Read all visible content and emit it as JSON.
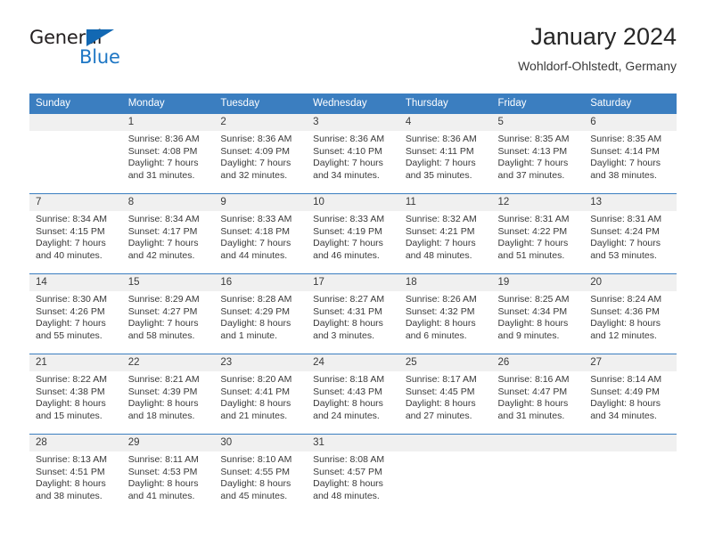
{
  "brand": {
    "name_part1": "General",
    "name_part2": "Blue",
    "accent_color": "#1d76c4",
    "triangle_color": "#1268b3"
  },
  "header": {
    "title": "January 2024",
    "subtitle": "Wohldorf-Ohlstedt, Germany",
    "header_bg_color": "#3b7ec0",
    "daynum_bg_color": "#f0f0f0"
  },
  "weekday_headers": [
    "Sunday",
    "Monday",
    "Tuesday",
    "Wednesday",
    "Thursday",
    "Friday",
    "Saturday"
  ],
  "weeks": [
    [
      {
        "date": "",
        "empty": true,
        "sunrise": "",
        "sunset": "",
        "daylight_line1": "",
        "daylight_line2": ""
      },
      {
        "date": "1",
        "empty": false,
        "sunrise": "Sunrise: 8:36 AM",
        "sunset": "Sunset: 4:08 PM",
        "daylight_line1": "Daylight: 7 hours",
        "daylight_line2": "and 31 minutes."
      },
      {
        "date": "2",
        "empty": false,
        "sunrise": "Sunrise: 8:36 AM",
        "sunset": "Sunset: 4:09 PM",
        "daylight_line1": "Daylight: 7 hours",
        "daylight_line2": "and 32 minutes."
      },
      {
        "date": "3",
        "empty": false,
        "sunrise": "Sunrise: 8:36 AM",
        "sunset": "Sunset: 4:10 PM",
        "daylight_line1": "Daylight: 7 hours",
        "daylight_line2": "and 34 minutes."
      },
      {
        "date": "4",
        "empty": false,
        "sunrise": "Sunrise: 8:36 AM",
        "sunset": "Sunset: 4:11 PM",
        "daylight_line1": "Daylight: 7 hours",
        "daylight_line2": "and 35 minutes."
      },
      {
        "date": "5",
        "empty": false,
        "sunrise": "Sunrise: 8:35 AM",
        "sunset": "Sunset: 4:13 PM",
        "daylight_line1": "Daylight: 7 hours",
        "daylight_line2": "and 37 minutes."
      },
      {
        "date": "6",
        "empty": false,
        "sunrise": "Sunrise: 8:35 AM",
        "sunset": "Sunset: 4:14 PM",
        "daylight_line1": "Daylight: 7 hours",
        "daylight_line2": "and 38 minutes."
      }
    ],
    [
      {
        "date": "7",
        "empty": false,
        "sunrise": "Sunrise: 8:34 AM",
        "sunset": "Sunset: 4:15 PM",
        "daylight_line1": "Daylight: 7 hours",
        "daylight_line2": "and 40 minutes."
      },
      {
        "date": "8",
        "empty": false,
        "sunrise": "Sunrise: 8:34 AM",
        "sunset": "Sunset: 4:17 PM",
        "daylight_line1": "Daylight: 7 hours",
        "daylight_line2": "and 42 minutes."
      },
      {
        "date": "9",
        "empty": false,
        "sunrise": "Sunrise: 8:33 AM",
        "sunset": "Sunset: 4:18 PM",
        "daylight_line1": "Daylight: 7 hours",
        "daylight_line2": "and 44 minutes."
      },
      {
        "date": "10",
        "empty": false,
        "sunrise": "Sunrise: 8:33 AM",
        "sunset": "Sunset: 4:19 PM",
        "daylight_line1": "Daylight: 7 hours",
        "daylight_line2": "and 46 minutes."
      },
      {
        "date": "11",
        "empty": false,
        "sunrise": "Sunrise: 8:32 AM",
        "sunset": "Sunset: 4:21 PM",
        "daylight_line1": "Daylight: 7 hours",
        "daylight_line2": "and 48 minutes."
      },
      {
        "date": "12",
        "empty": false,
        "sunrise": "Sunrise: 8:31 AM",
        "sunset": "Sunset: 4:22 PM",
        "daylight_line1": "Daylight: 7 hours",
        "daylight_line2": "and 51 minutes."
      },
      {
        "date": "13",
        "empty": false,
        "sunrise": "Sunrise: 8:31 AM",
        "sunset": "Sunset: 4:24 PM",
        "daylight_line1": "Daylight: 7 hours",
        "daylight_line2": "and 53 minutes."
      }
    ],
    [
      {
        "date": "14",
        "empty": false,
        "sunrise": "Sunrise: 8:30 AM",
        "sunset": "Sunset: 4:26 PM",
        "daylight_line1": "Daylight: 7 hours",
        "daylight_line2": "and 55 minutes."
      },
      {
        "date": "15",
        "empty": false,
        "sunrise": "Sunrise: 8:29 AM",
        "sunset": "Sunset: 4:27 PM",
        "daylight_line1": "Daylight: 7 hours",
        "daylight_line2": "and 58 minutes."
      },
      {
        "date": "16",
        "empty": false,
        "sunrise": "Sunrise: 8:28 AM",
        "sunset": "Sunset: 4:29 PM",
        "daylight_line1": "Daylight: 8 hours",
        "daylight_line2": "and 1 minute."
      },
      {
        "date": "17",
        "empty": false,
        "sunrise": "Sunrise: 8:27 AM",
        "sunset": "Sunset: 4:31 PM",
        "daylight_line1": "Daylight: 8 hours",
        "daylight_line2": "and 3 minutes."
      },
      {
        "date": "18",
        "empty": false,
        "sunrise": "Sunrise: 8:26 AM",
        "sunset": "Sunset: 4:32 PM",
        "daylight_line1": "Daylight: 8 hours",
        "daylight_line2": "and 6 minutes."
      },
      {
        "date": "19",
        "empty": false,
        "sunrise": "Sunrise: 8:25 AM",
        "sunset": "Sunset: 4:34 PM",
        "daylight_line1": "Daylight: 8 hours",
        "daylight_line2": "and 9 minutes."
      },
      {
        "date": "20",
        "empty": false,
        "sunrise": "Sunrise: 8:24 AM",
        "sunset": "Sunset: 4:36 PM",
        "daylight_line1": "Daylight: 8 hours",
        "daylight_line2": "and 12 minutes."
      }
    ],
    [
      {
        "date": "21",
        "empty": false,
        "sunrise": "Sunrise: 8:22 AM",
        "sunset": "Sunset: 4:38 PM",
        "daylight_line1": "Daylight: 8 hours",
        "daylight_line2": "and 15 minutes."
      },
      {
        "date": "22",
        "empty": false,
        "sunrise": "Sunrise: 8:21 AM",
        "sunset": "Sunset: 4:39 PM",
        "daylight_line1": "Daylight: 8 hours",
        "daylight_line2": "and 18 minutes."
      },
      {
        "date": "23",
        "empty": false,
        "sunrise": "Sunrise: 8:20 AM",
        "sunset": "Sunset: 4:41 PM",
        "daylight_line1": "Daylight: 8 hours",
        "daylight_line2": "and 21 minutes."
      },
      {
        "date": "24",
        "empty": false,
        "sunrise": "Sunrise: 8:18 AM",
        "sunset": "Sunset: 4:43 PM",
        "daylight_line1": "Daylight: 8 hours",
        "daylight_line2": "and 24 minutes."
      },
      {
        "date": "25",
        "empty": false,
        "sunrise": "Sunrise: 8:17 AM",
        "sunset": "Sunset: 4:45 PM",
        "daylight_line1": "Daylight: 8 hours",
        "daylight_line2": "and 27 minutes."
      },
      {
        "date": "26",
        "empty": false,
        "sunrise": "Sunrise: 8:16 AM",
        "sunset": "Sunset: 4:47 PM",
        "daylight_line1": "Daylight: 8 hours",
        "daylight_line2": "and 31 minutes."
      },
      {
        "date": "27",
        "empty": false,
        "sunrise": "Sunrise: 8:14 AM",
        "sunset": "Sunset: 4:49 PM",
        "daylight_line1": "Daylight: 8 hours",
        "daylight_line2": "and 34 minutes."
      }
    ],
    [
      {
        "date": "28",
        "empty": false,
        "sunrise": "Sunrise: 8:13 AM",
        "sunset": "Sunset: 4:51 PM",
        "daylight_line1": "Daylight: 8 hours",
        "daylight_line2": "and 38 minutes."
      },
      {
        "date": "29",
        "empty": false,
        "sunrise": "Sunrise: 8:11 AM",
        "sunset": "Sunset: 4:53 PM",
        "daylight_line1": "Daylight: 8 hours",
        "daylight_line2": "and 41 minutes."
      },
      {
        "date": "30",
        "empty": false,
        "sunrise": "Sunrise: 8:10 AM",
        "sunset": "Sunset: 4:55 PM",
        "daylight_line1": "Daylight: 8 hours",
        "daylight_line2": "and 45 minutes."
      },
      {
        "date": "31",
        "empty": false,
        "sunrise": "Sunrise: 8:08 AM",
        "sunset": "Sunset: 4:57 PM",
        "daylight_line1": "Daylight: 8 hours",
        "daylight_line2": "and 48 minutes."
      },
      {
        "date": "",
        "empty": true,
        "sunrise": "",
        "sunset": "",
        "daylight_line1": "",
        "daylight_line2": ""
      },
      {
        "date": "",
        "empty": true,
        "sunrise": "",
        "sunset": "",
        "daylight_line1": "",
        "daylight_line2": ""
      },
      {
        "date": "",
        "empty": true,
        "sunrise": "",
        "sunset": "",
        "daylight_line1": "",
        "daylight_line2": ""
      }
    ]
  ]
}
